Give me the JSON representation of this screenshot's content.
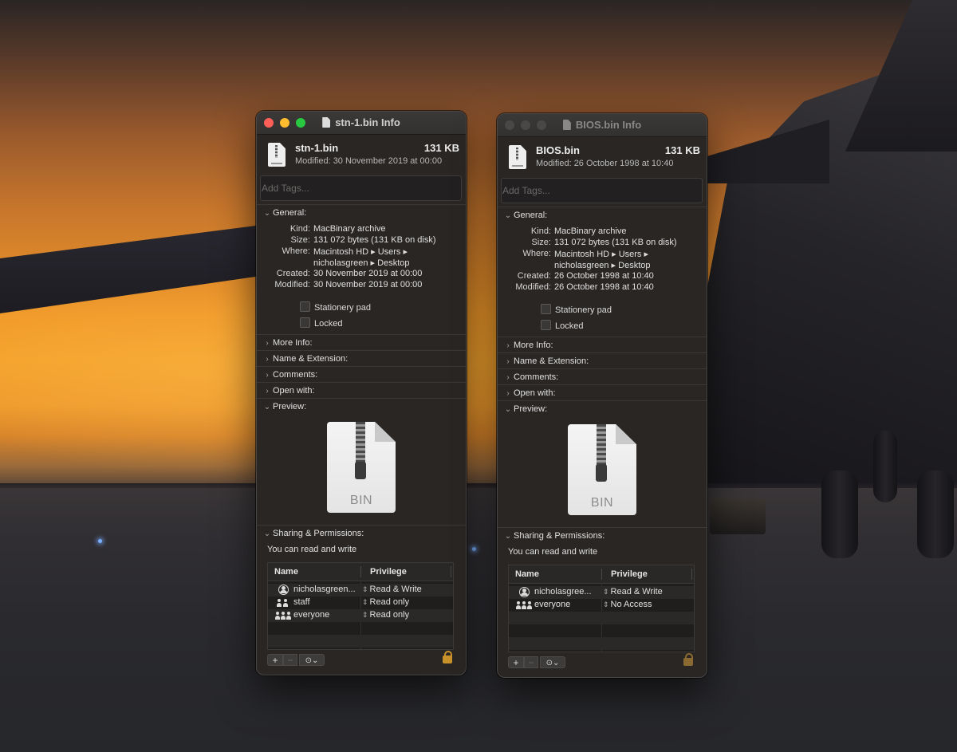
{
  "windows": [
    {
      "title": "stn-1.bin Info",
      "state": "active",
      "file_name": "stn-1.bin",
      "file_size": "131 KB",
      "modified_summary": "Modified: 30 November 2019 at 00:00",
      "tags_placeholder": "Add Tags...",
      "general": {
        "label": "General:",
        "kind_label": "Kind:",
        "kind": "MacBinary archive",
        "size_label": "Size:",
        "size": "131 072 bytes (131 KB on disk)",
        "where_label": "Where:",
        "where_line1": "Macintosh HD ▸ Users ▸",
        "where_line2": "nicholasgreen ▸ Desktop",
        "created_label": "Created:",
        "created": "30 November 2019 at 00:00",
        "modified_label": "Modified:",
        "modified": "30 November 2019 at 00:00",
        "stationery_label": "Stationery pad",
        "locked_label": "Locked"
      },
      "sections": {
        "more_info": "More Info:",
        "name_ext": "Name & Extension:",
        "comments": "Comments:",
        "open_with": "Open with:",
        "preview": "Preview:",
        "sharing": "Sharing & Permissions:"
      },
      "preview_ext": "BIN",
      "permission_summary": "You can read and write",
      "table_headers": {
        "name": "Name",
        "privilege": "Privilege"
      },
      "permissions": [
        {
          "icon": "user-icon",
          "name": "nicholasgreen...",
          "privilege": "Read & Write"
        },
        {
          "icon": "group-icon",
          "name": "staff",
          "privilege": "Read only"
        },
        {
          "icon": "group-icon",
          "name": "everyone",
          "privilege": "Read only"
        }
      ],
      "buttons": {
        "add": "+",
        "remove": "−",
        "action": "⊙⌄"
      }
    },
    {
      "title": "BIOS.bin Info",
      "state": "inactive",
      "file_name": "BIOS.bin",
      "file_size": "131 KB",
      "modified_summary": "Modified: 26 October 1998 at 10:40",
      "tags_placeholder": "Add Tags...",
      "general": {
        "label": "General:",
        "kind_label": "Kind:",
        "kind": "MacBinary archive",
        "size_label": "Size:",
        "size": "131 072 bytes (131 KB on disk)",
        "where_label": "Where:",
        "where_line1": "Macintosh HD ▸ Users ▸",
        "where_line2": "nicholasgreen ▸ Desktop",
        "created_label": "Created:",
        "created": "26 October 1998 at 10:40",
        "modified_label": "Modified:",
        "modified": "26 October 1998 at 10:40",
        "stationery_label": "Stationery pad",
        "locked_label": "Locked"
      },
      "sections": {
        "more_info": "More Info:",
        "name_ext": "Name & Extension:",
        "comments": "Comments:",
        "open_with": "Open with:",
        "preview": "Preview:",
        "sharing": "Sharing & Permissions:"
      },
      "preview_ext": "BIN",
      "permission_summary": "You can read and write",
      "table_headers": {
        "name": "Name",
        "privilege": "Privilege"
      },
      "permissions": [
        {
          "icon": "user-icon",
          "name": "nicholasgree...",
          "privilege": "Read & Write"
        },
        {
          "icon": "group-icon",
          "name": "everyone",
          "privilege": "No Access"
        }
      ],
      "buttons": {
        "add": "+",
        "remove": "−",
        "action": "⊙⌄"
      }
    }
  ],
  "colors": {
    "close": "#ff5f57",
    "minimize": "#febc2e",
    "zoom": "#28c840",
    "lock": "#c9912a",
    "window_bg": "#292624"
  }
}
